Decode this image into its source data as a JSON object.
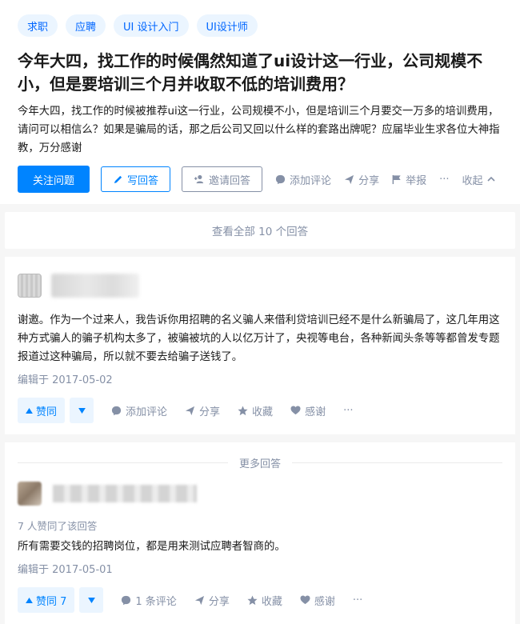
{
  "question": {
    "topics": [
      "求职",
      "应聘",
      "UI 设计入门",
      "UI设计师"
    ],
    "title": "今年大四，找工作的时候偶然知道了ui设计这一行业，公司规模不小，但是要培训三个月并收取不低的培训费用？",
    "description": "今年大四，找工作的时候被推荐ui这一行业，公司规模不小，但是培训三个月要交一万多的培训费用，请问可以相信么？如果是骗局的话，那之后公司又回以什么样的套路出牌呢？应届毕业生求各位大神指教，万分感谢",
    "actions": {
      "follow": "关注问题",
      "write": "写回答",
      "invite": "邀请回答",
      "comment": "添加评论",
      "share": "分享",
      "report": "举报",
      "more": "···",
      "collapse": "收起"
    }
  },
  "view_all": "查看全部 10 个回答",
  "answers": [
    {
      "content": "谢邀。作为一个过来人，我告诉你用招聘的名义骗人来借利贷培训已经不是什么新骗局了，这几年用这种方式骗人的骗子机构太多了，被骗被坑的人以亿万计了，央视等电台，各种新闻头条等等都曾发专题报道过这种骗局，所以就不要去给骗子送钱了。",
      "edited": "编辑于 2017-05-02",
      "vote_label": "赞同",
      "comment": "添加评论",
      "share": "分享",
      "collect": "收藏",
      "thanks": "感谢",
      "more": "···"
    },
    {
      "votes_line": "7 人赞同了该回答",
      "content": "所有需要交钱的招聘岗位，都是用来测试应聘者智商的。",
      "edited": "编辑于 2017-05-01",
      "vote_label": "赞同 7",
      "comment": "1 条评论",
      "share": "分享",
      "collect": "收藏",
      "thanks": "感谢",
      "more": "···"
    }
  ],
  "more_answers": "更多回答",
  "colors": {
    "brand": "#0084ff",
    "muted": "#8590a6",
    "tag_bg": "#ebf5ff"
  }
}
